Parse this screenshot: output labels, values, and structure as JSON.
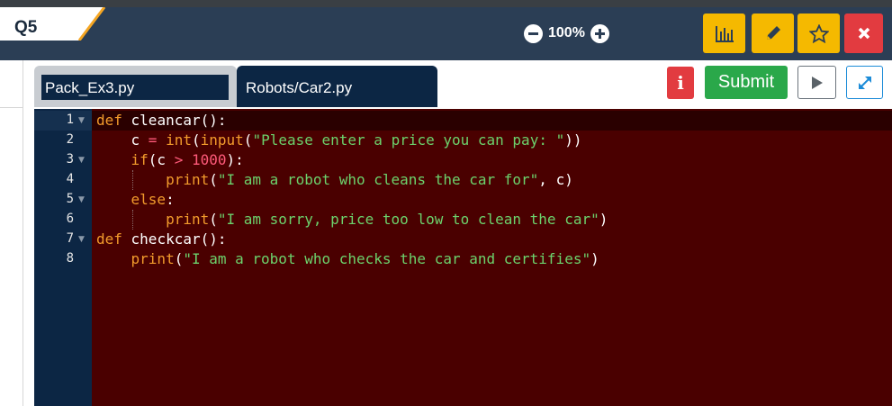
{
  "header": {
    "question_label": "Q5",
    "zoom_level": "100%",
    "tools": [
      {
        "name": "stats",
        "icon": "bar-chart-icon"
      },
      {
        "name": "edit",
        "icon": "pencil-icon"
      },
      {
        "name": "favorite",
        "icon": "star-icon"
      },
      {
        "name": "close",
        "icon": "close-icon"
      }
    ]
  },
  "file_tabs": [
    {
      "label": "Pack_Ex3.py"
    },
    {
      "label": "Robots/Car2.py"
    }
  ],
  "actions": {
    "info_label": "i",
    "submit_label": "Submit"
  },
  "editor": {
    "line_numbers": [
      "1",
      "2",
      "3",
      "4",
      "5",
      "6",
      "7",
      "8"
    ],
    "lines": [
      "def cleancar():",
      "    c = int(input(\"Please enter a price you can pay: \"))",
      "    if(c > 1000):",
      "        print(\"I am a robot who cleans the car for\", c)",
      "    else:",
      "        print(\"I am sorry, price too low to clean the car\")",
      "def checkcar():",
      "    print(\"I am a robot who checks the car and certifies\")"
    ]
  },
  "colors": {
    "header_bg": "#2b3e55",
    "editor_bg": "#4a0000",
    "gutter_bg": "#0c2644",
    "submit_green": "#2aa84a",
    "tool_yellow": "#f5b900",
    "close_red": "#e23b40"
  }
}
